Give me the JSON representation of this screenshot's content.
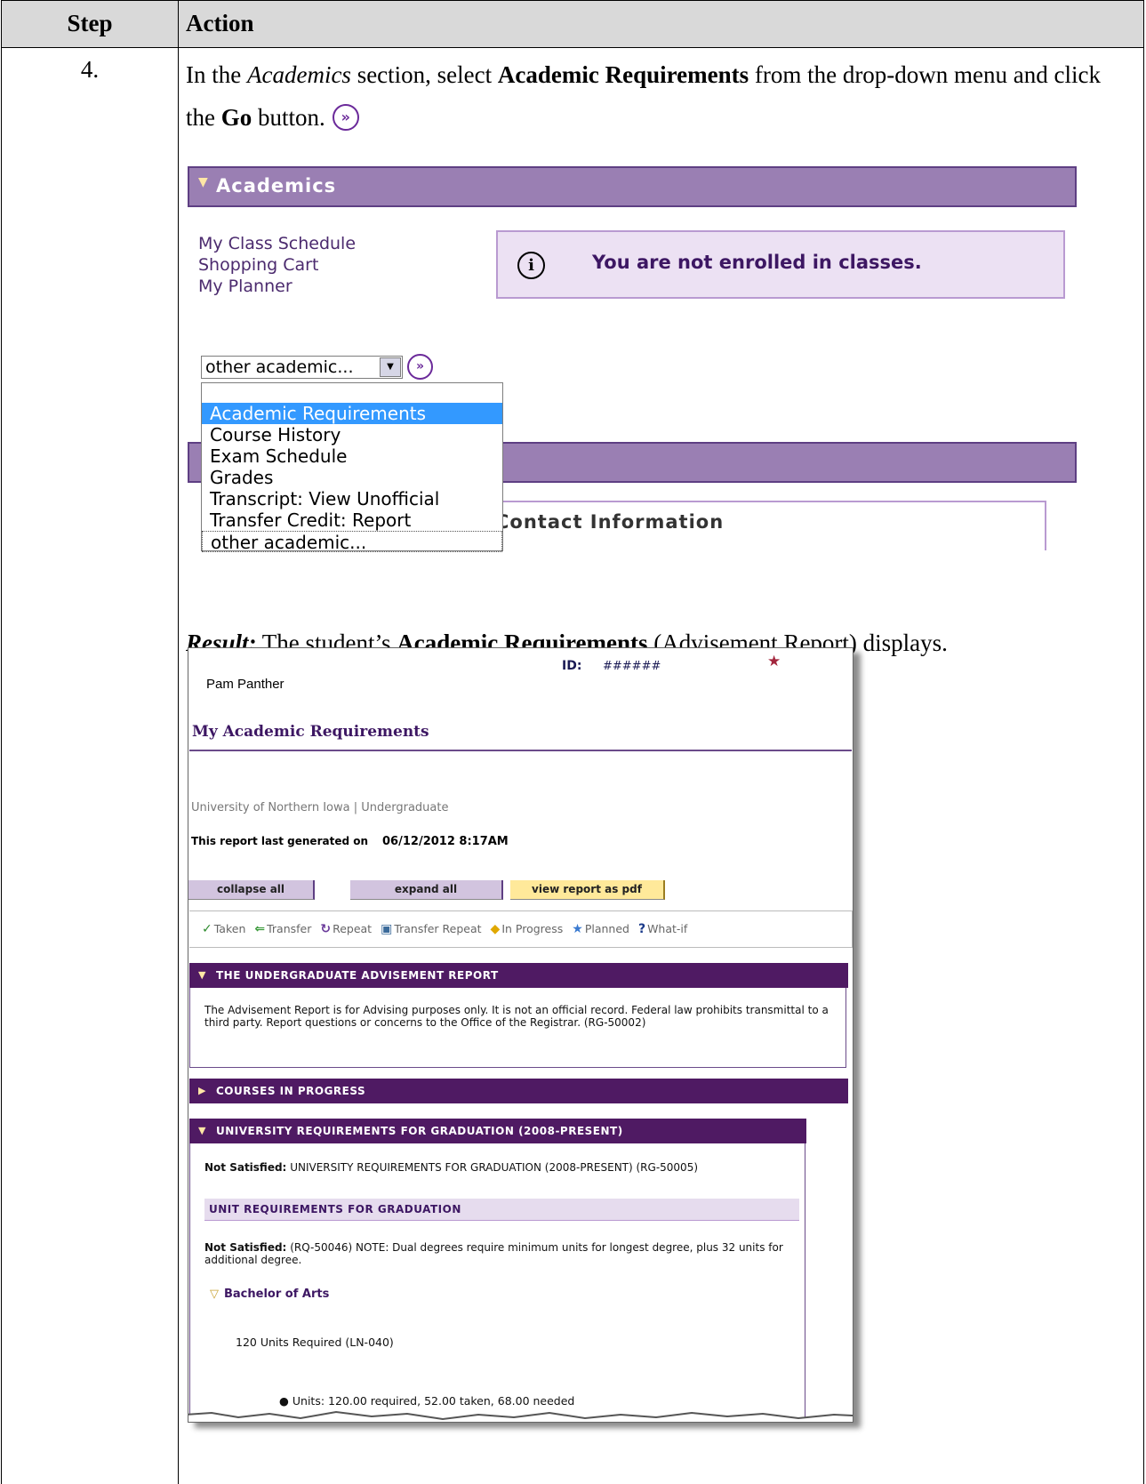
{
  "table": {
    "col_step": "Step",
    "col_action": "Action",
    "step_number": "4."
  },
  "instruction": {
    "p1": "In the ",
    "section_name": "Academics",
    "p2": " section, select ",
    "item": "Academic Requirements",
    "p3": " from the drop-down menu and click the ",
    "button": "Go",
    "p4": " button."
  },
  "academics": {
    "title": "Academics",
    "links": [
      "My Class Schedule",
      "Shopping Cart",
      "My Planner"
    ],
    "notice": "You are not enrolled in classes.",
    "select_value": "other academic...",
    "dropdown_options": [
      "",
      "Academic Requirements",
      "Course History",
      "Exam Schedule",
      "Grades",
      "Transcript: View Unofficial",
      "Transfer Credit: Report",
      "other academic..."
    ],
    "selected_option": "Academic Requirements",
    "contact_title": "Contact Information"
  },
  "result": {
    "label": "Result:",
    "p1": " The student’s ",
    "item": "Academic Requirements",
    "p2": " (Advisement Report) displays."
  },
  "report": {
    "student_name": "Pam Panther",
    "id_label": "ID:",
    "id_value": "######",
    "title": "My Academic Requirements",
    "institution": "University of Northern Iowa | Undergraduate",
    "generated_label": "This report last generated on",
    "generated_value": "06/12/2012  8:17AM",
    "buttons": {
      "collapse": "collapse all",
      "expand": "expand all",
      "pdf": "view report as pdf"
    },
    "legend": [
      {
        "icon": "taken-check-icon",
        "label": "Taken"
      },
      {
        "icon": "transfer-arrow-icon",
        "label": "Transfer"
      },
      {
        "icon": "repeat-icon",
        "label": "Repeat"
      },
      {
        "icon": "transfer-repeat-icon",
        "label": "Transfer Repeat"
      },
      {
        "icon": "in-progress-diamond-icon",
        "label": "In Progress"
      },
      {
        "icon": "planned-star-icon",
        "label": "Planned"
      },
      {
        "icon": "what-if-question-icon",
        "label": "What-if"
      }
    ],
    "sec1_title": "THE UNDERGRADUATE ADVISEMENT REPORT",
    "sec1_text": "The Advisement Report is for Advising purposes only. It is not an official record. Federal law prohibits transmittal to a third party. Report questions or concerns to the Office of the Registrar. (RG-50002)",
    "sec2_title": "COURSES IN PROGRESS",
    "sec3_title": "UNIVERSITY REQUIREMENTS FOR GRADUATION (2008-PRESENT)",
    "sec3_status_label": "Not Satisfied:",
    "sec3_status_text": "UNIVERSITY REQUIREMENTS FOR GRADUATION (2008-PRESENT) (RG-50005)",
    "sub_title": "UNIT REQUIREMENTS FOR GRADUATION",
    "sub_status_label": "Not Satisfied:",
    "sub_status_text": "(RQ-50046) NOTE: Dual degrees require minimum units for longest degree, plus 32 units for additional degree.",
    "degree": "Bachelor of Arts",
    "units_req": "120 Units Required (LN-040)",
    "units_line": "Units: 120.00 required, 52.00 taken, 68.00 needed"
  },
  "colors": {
    "academics_bar": "#9a7fb3",
    "section_bar": "#4f1a63",
    "accent_text": "#3d1763",
    "header_fill": "#d9d9d9"
  }
}
